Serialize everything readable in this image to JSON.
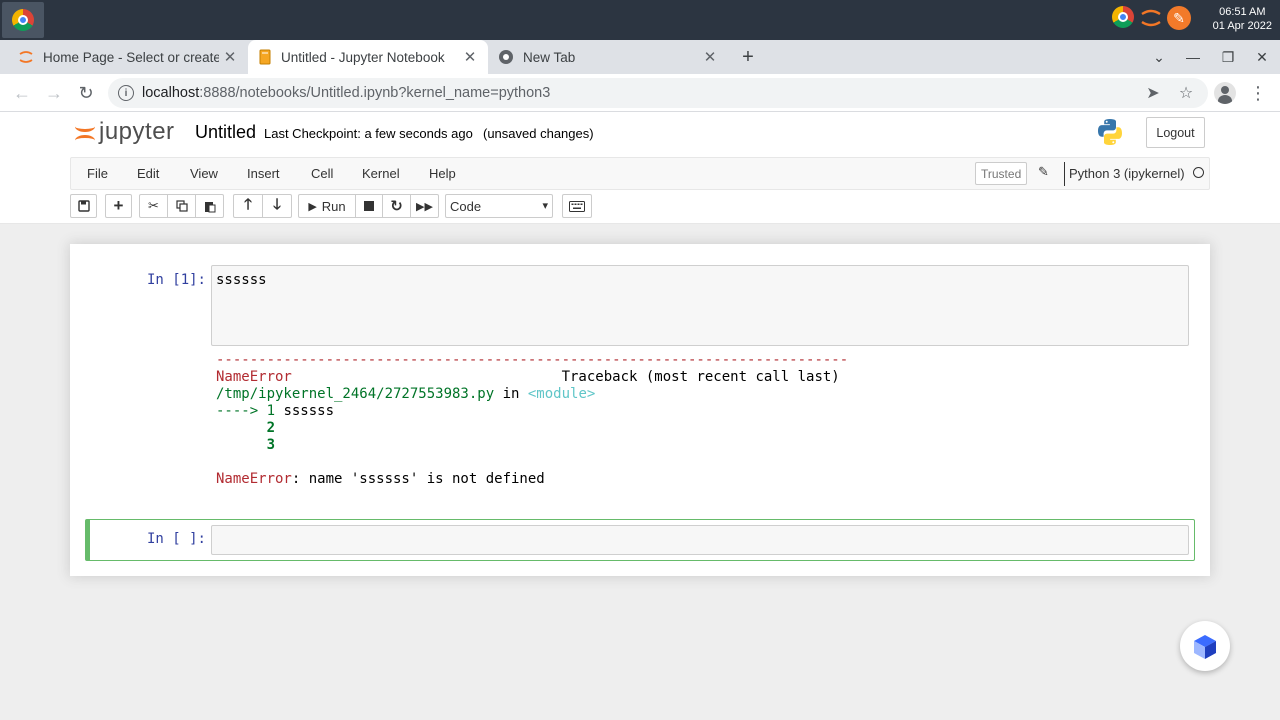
{
  "taskbar": {
    "clock_time": "06:51 AM",
    "clock_date": "01 Apr 2022"
  },
  "browser": {
    "tabs": [
      {
        "title": "Home Page - Select or create a notebook",
        "favicon": "jupyter-icon"
      },
      {
        "title": "Untitled - Jupyter Notebook",
        "favicon": "notebook-icon",
        "active": true
      },
      {
        "title": "New Tab",
        "favicon": "chrome-icon"
      }
    ],
    "url_host": "localhost",
    "url_rest": ":8888/notebooks/Untitled.ipynb?kernel_name=python3"
  },
  "jupyter": {
    "logo_text": "jupyter",
    "notebook_title": "Untitled",
    "checkpoint": "Last Checkpoint: a few seconds ago",
    "autosave_status": "(unsaved changes)",
    "logout_label": "Logout",
    "menu": [
      "File",
      "Edit",
      "View",
      "Insert",
      "Cell",
      "Kernel",
      "Help"
    ],
    "trusted_label": "Trusted",
    "kernel_name": "Python 3 (ipykernel)",
    "toolbar": {
      "run_label": "Run",
      "cell_type": "Code"
    }
  },
  "cells": [
    {
      "prompt": "In [1]:",
      "source": "ssssss",
      "output": {
        "dashes": "---------------------------------------------------------------------------",
        "error_name": "NameError",
        "traceback_header": "Traceback (most recent call last)",
        "file": "/tmp/ipykernel_2464/2727553983.py",
        "in_word": " in ",
        "module": "<module>",
        "arrow": "----> 1 ",
        "line1_code": "ssssss",
        "line2": "      2",
        "line3": "      3",
        "error_message": ": name 'ssssss' is not defined"
      }
    },
    {
      "prompt": "In [ ]:",
      "source": ""
    }
  ]
}
